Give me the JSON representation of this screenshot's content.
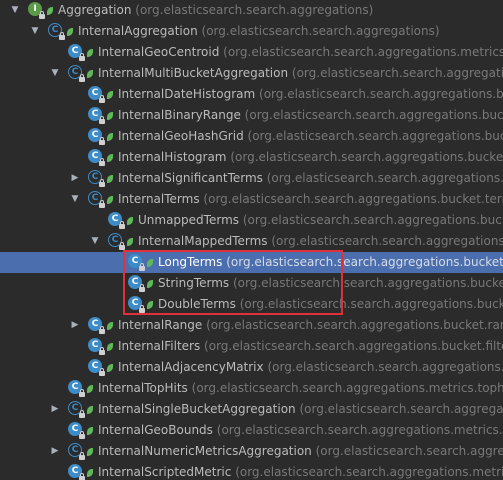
{
  "tree": {
    "nodes": [
      {
        "name": "Aggregation",
        "pkg": "(org.elasticsearch.search.aggregations)",
        "arrow": "▼",
        "icon": "interface-icon"
      },
      {
        "name": "InternalAggregation",
        "pkg": "(org.elasticsearch.search.aggregations)",
        "arrow": "▼",
        "icon": "abstract-class-icon"
      },
      {
        "name": "InternalGeoCentroid",
        "pkg": "(org.elasticsearch.search.aggregations.metrics.geocentroid)",
        "arrow": "",
        "icon": "class-icon"
      },
      {
        "name": "InternalMultiBucketAggregation",
        "pkg": "(org.elasticsearch.search.aggregations)",
        "arrow": "▼",
        "icon": "abstract-class-icon"
      },
      {
        "name": "InternalDateHistogram",
        "pkg": "(org.elasticsearch.search.aggregations.bucket.histogram)",
        "arrow": "",
        "icon": "class-icon"
      },
      {
        "name": "InternalBinaryRange",
        "pkg": "(org.elasticsearch.search.aggregations.bucket.range)",
        "arrow": "",
        "icon": "class-icon"
      },
      {
        "name": "InternalGeoHashGrid",
        "pkg": "(org.elasticsearch.search.aggregations.bucket.geogrid)",
        "arrow": "",
        "icon": "class-icon"
      },
      {
        "name": "InternalHistogram",
        "pkg": "(org.elasticsearch.search.aggregations.bucket.histogram)",
        "arrow": "",
        "icon": "class-icon"
      },
      {
        "name": "InternalSignificantTerms",
        "pkg": "(org.elasticsearch.search.aggregations.bucket.significant)",
        "arrow": "▶",
        "icon": "abstract-class-icon"
      },
      {
        "name": "InternalTerms",
        "pkg": "(org.elasticsearch.search.aggregations.bucket.terms)",
        "arrow": "▼",
        "icon": "abstract-class-icon"
      },
      {
        "name": "UnmappedTerms",
        "pkg": "(org.elasticsearch.search.aggregations.bucket.terms)",
        "arrow": "",
        "icon": "class-icon"
      },
      {
        "name": "InternalMappedTerms",
        "pkg": "(org.elasticsearch.search.aggregations.bucket.terms)",
        "arrow": "▼",
        "icon": "abstract-class-icon"
      },
      {
        "name": "LongTerms",
        "pkg": "(org.elasticsearch.search.aggregations.bucket.terms)",
        "arrow": "",
        "icon": "class-icon",
        "selected": true
      },
      {
        "name": "StringTerms",
        "pkg": "(org.elasticsearch.search.aggregations.bucket.terms)",
        "arrow": "",
        "icon": "class-icon"
      },
      {
        "name": "DoubleTerms",
        "pkg": "(org.elasticsearch.search.aggregations.bucket.terms)",
        "arrow": "",
        "icon": "class-icon"
      },
      {
        "name": "InternalRange",
        "pkg": "(org.elasticsearch.search.aggregations.bucket.range)",
        "arrow": "▶",
        "icon": "class-icon"
      },
      {
        "name": "InternalFilters",
        "pkg": "(org.elasticsearch.search.aggregations.bucket.filters)",
        "arrow": "",
        "icon": "class-icon"
      },
      {
        "name": "InternalAdjacencyMatrix",
        "pkg": "(org.elasticsearch.search.aggregations.bucket.adjacency)",
        "arrow": "",
        "icon": "class-icon"
      },
      {
        "name": "InternalTopHits",
        "pkg": "(org.elasticsearch.search.aggregations.metrics.tophits)",
        "arrow": "",
        "icon": "class-icon"
      },
      {
        "name": "InternalSingleBucketAggregation",
        "pkg": "(org.elasticsearch.search.aggregations.bucket)",
        "arrow": "▶",
        "icon": "abstract-class-icon"
      },
      {
        "name": "InternalGeoBounds",
        "pkg": "(org.elasticsearch.search.aggregations.metrics.geobounds)",
        "arrow": "",
        "icon": "class-icon"
      },
      {
        "name": "InternalNumericMetricsAggregation",
        "pkg": "(org.elasticsearch.search.aggregations.metrics)",
        "arrow": "▶",
        "icon": "abstract-class-icon"
      },
      {
        "name": "InternalScriptedMetric",
        "pkg": "(org.elasticsearch.search.aggregations.metrics.scripted)",
        "arrow": "",
        "icon": "class-icon"
      }
    ]
  },
  "colors": {
    "background": "#2b2b2b",
    "selection": "#4b6eaf",
    "highlight_box": "#e0313b",
    "class_icon": "#3d8cc8",
    "public_leaf": "#5fb85a"
  }
}
